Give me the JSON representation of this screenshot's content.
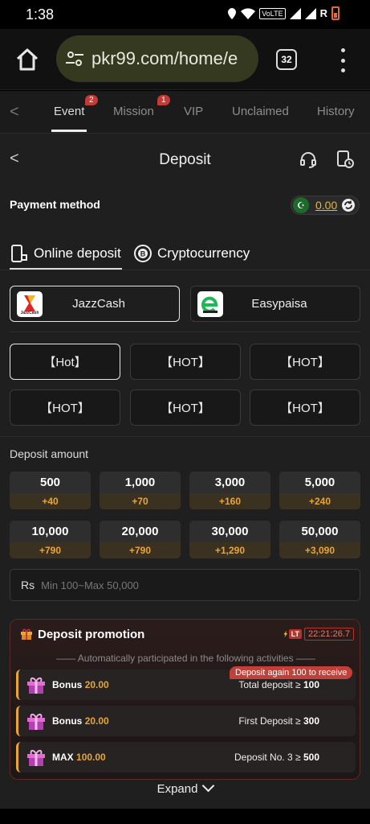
{
  "status_bar": {
    "time": "1:38",
    "volte": "VoLTE",
    "carrier": "R"
  },
  "browser": {
    "url": "pkr99.com/home/e",
    "tab_count": "32"
  },
  "top_nav": {
    "tabs": [
      {
        "label": "Event",
        "badge": "2"
      },
      {
        "label": "Mission",
        "badge": "1"
      },
      {
        "label": "VIP"
      },
      {
        "label": "Unclaimed"
      },
      {
        "label": "History"
      }
    ]
  },
  "header": {
    "title": "Deposit"
  },
  "payment": {
    "label": "Payment method",
    "balance": "0.00",
    "method_tabs": [
      "Online deposit",
      "Cryptocurrency"
    ],
    "channels": [
      "JazzCash",
      "Easypaisa"
    ],
    "jazzcash_logo_text": "JazzCash",
    "options": [
      "【Hot】",
      "【HOT】",
      "【HOT】",
      "【HOT】",
      "【HOT】",
      "【HOT】"
    ]
  },
  "deposit": {
    "label": "Deposit amount",
    "amounts": [
      {
        "value": "500",
        "bonus": "+40"
      },
      {
        "value": "1,000",
        "bonus": "+70"
      },
      {
        "value": "3,000",
        "bonus": "+160"
      },
      {
        "value": "5,000",
        "bonus": "+240"
      },
      {
        "value": "10,000",
        "bonus": "+790"
      },
      {
        "value": "20,000",
        "bonus": "+790"
      },
      {
        "value": "30,000",
        "bonus": "+1,290"
      },
      {
        "value": "50,000",
        "bonus": "+3,090"
      }
    ],
    "currency": "Rs",
    "placeholder": "Min 100~Max 50,000"
  },
  "promotion": {
    "title": "Deposit promotion",
    "lt_tag": "LT",
    "timer": "22:21:26.7",
    "subtitle": "—— Automatically participated in the following activities ——",
    "again_tip": "Deposit again 100 to receive",
    "rows": [
      {
        "prefix": "Bonus",
        "value": "20.00",
        "cond_text": "Total deposit ≥",
        "cond_value": "100"
      },
      {
        "prefix": "Bonus",
        "value": "20.00",
        "cond_text": "First Deposit ≥",
        "cond_value": "300"
      },
      {
        "prefix": "MAX",
        "value": "100.00",
        "cond_text": "Deposit No. 3 ≥",
        "cond_value": "500"
      }
    ],
    "expand_label": "Expand"
  },
  "colors": {
    "accent": "#e8a53a",
    "danger": "#c2403a",
    "panel": "#1f1f1f"
  }
}
